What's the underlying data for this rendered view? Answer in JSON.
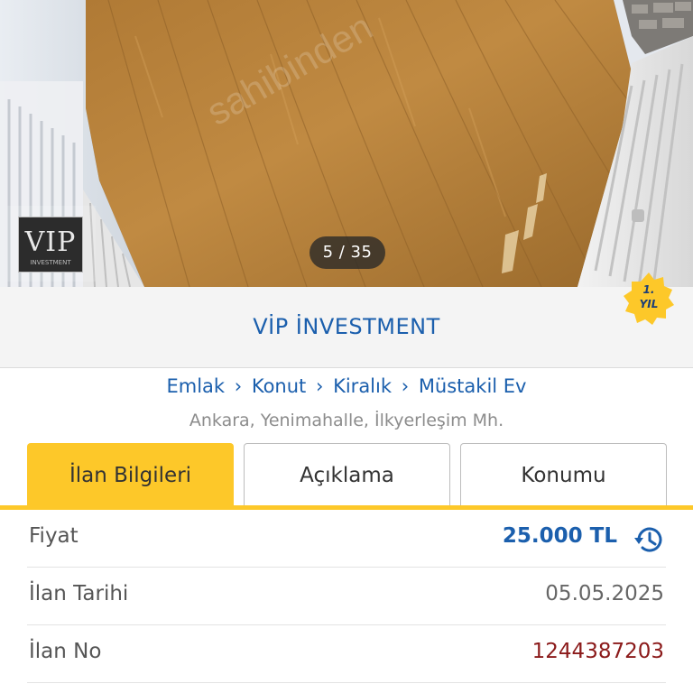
{
  "gallery": {
    "counter": "5 / 35",
    "logo_text": "VIP",
    "logo_subtext": "INVESTMENT",
    "watermark": "sahibinden"
  },
  "store": {
    "name": "VİP İNVESTMENT",
    "badge_line1": "1.",
    "badge_line2": "YIL"
  },
  "breadcrumb": {
    "items": [
      "Emlak",
      "Konut",
      "Kiralık",
      "Müstakil Ev"
    ],
    "separator": "›"
  },
  "location": "Ankara, Yenimahalle, İlkyerleşim Mh.",
  "tabs": [
    {
      "label": "İlan Bilgileri",
      "active": true
    },
    {
      "label": "Açıklama",
      "active": false
    },
    {
      "label": "Konumu",
      "active": false
    }
  ],
  "info": {
    "price_label": "Fiyat",
    "price_value": "25.000 TL",
    "date_label": "İlan Tarihi",
    "date_value": "05.05.2025",
    "id_label": "İlan No",
    "id_value": "1244387203"
  },
  "icons": {
    "price_history": "history-icon"
  },
  "colors": {
    "accent_yellow": "#fdc829",
    "link_blue": "#1b5fad",
    "id_red": "#8b1a1a"
  }
}
